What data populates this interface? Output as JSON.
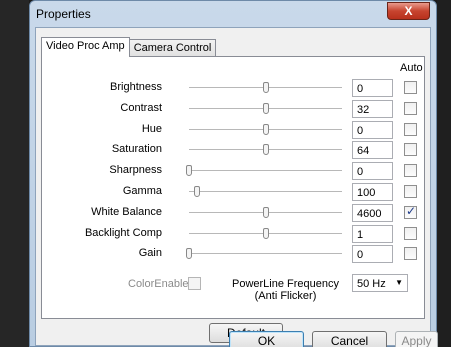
{
  "window": {
    "title": "Properties",
    "close_label": "X"
  },
  "tabs": [
    {
      "label": "Video Proc Amp",
      "active": true
    },
    {
      "label": "Camera Control",
      "active": false
    }
  ],
  "auto_header": "Auto",
  "properties": [
    {
      "label": "Brightness",
      "value": "0",
      "level": 0.5,
      "auto": false
    },
    {
      "label": "Contrast",
      "value": "32",
      "level": 0.5,
      "auto": false
    },
    {
      "label": "Hue",
      "value": "0",
      "level": 0.5,
      "auto": false
    },
    {
      "label": "Saturation",
      "value": "64",
      "level": 0.5,
      "auto": false
    },
    {
      "label": "Sharpness",
      "value": "0",
      "level": 0.0,
      "auto": false
    },
    {
      "label": "Gamma",
      "value": "100",
      "level": 0.05,
      "auto": false
    },
    {
      "label": "White Balance",
      "value": "4600",
      "level": 0.5,
      "auto": true
    },
    {
      "label": "Backlight Comp",
      "value": "1",
      "level": 0.5,
      "auto": false
    },
    {
      "label": "Gain",
      "value": "0",
      "level": 0.0,
      "auto": false
    }
  ],
  "color_enable": {
    "label": "ColorEnable",
    "checked": false
  },
  "powerline": {
    "label_line1": "PowerLine Frequency",
    "label_line2": "(Anti Flicker)",
    "value": "50 Hz"
  },
  "buttons": {
    "default": "Default",
    "ok": "OK",
    "cancel": "Cancel",
    "apply": "Apply"
  },
  "colors": {
    "title_bar": "#c9d9ea",
    "close_button": "#c7442f",
    "panel_bg": "#ffffff",
    "dialog_bg": "#f0f0f0"
  }
}
